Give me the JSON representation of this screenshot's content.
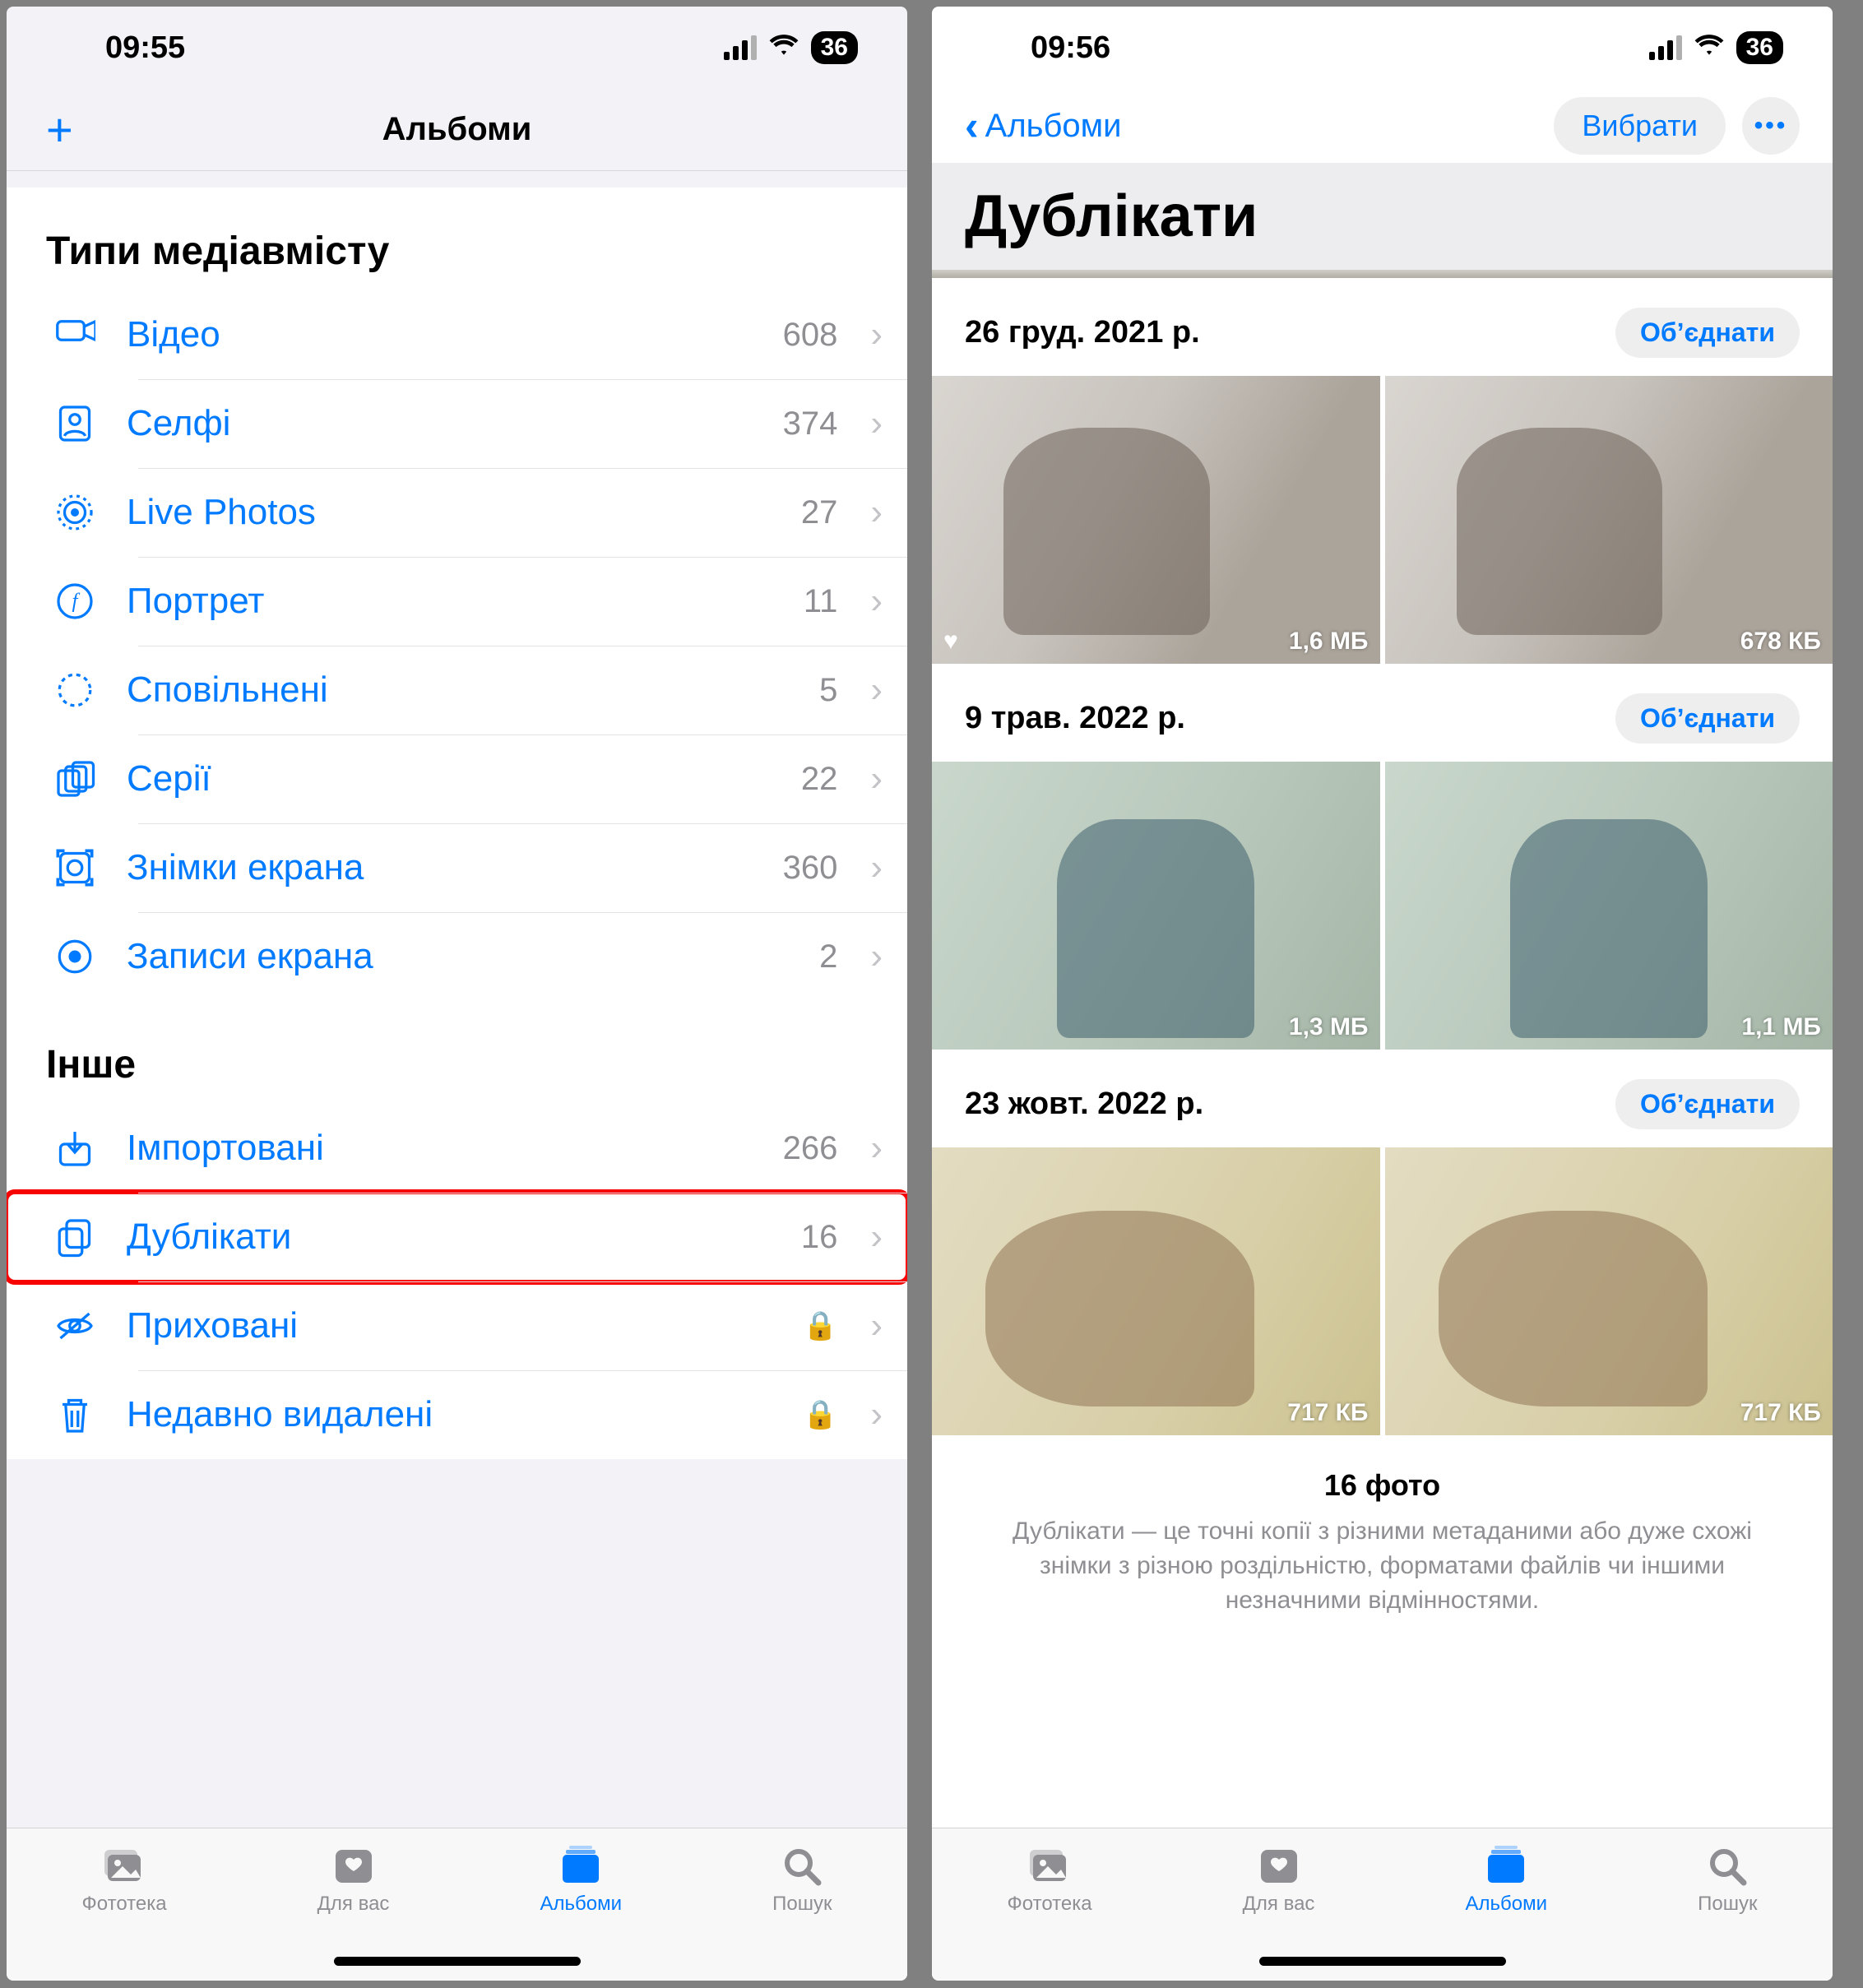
{
  "left": {
    "status_time": "09:55",
    "battery": "36",
    "nav_title": "Альбоми",
    "section_media": "Типи медіавмісту",
    "section_other": "Інше",
    "media_rows": [
      {
        "icon": "video-icon",
        "label": "Відео",
        "count": "608"
      },
      {
        "icon": "selfie-icon",
        "label": "Селфі",
        "count": "374"
      },
      {
        "icon": "livephotos-icon",
        "label": "Live Photos",
        "count": "27"
      },
      {
        "icon": "portrait-icon",
        "label": "Портрет",
        "count": "11"
      },
      {
        "icon": "slowmo-icon",
        "label": "Сповільнені",
        "count": "5"
      },
      {
        "icon": "burst-icon",
        "label": "Серії",
        "count": "22"
      },
      {
        "icon": "screenshot-icon",
        "label": "Знімки екрана",
        "count": "360"
      },
      {
        "icon": "screenrec-icon",
        "label": "Записи екрана",
        "count": "2"
      }
    ],
    "other_rows": [
      {
        "icon": "import-icon",
        "label": "Імпортовані",
        "count": "266",
        "lock": false,
        "hl": false
      },
      {
        "icon": "duplicates-icon",
        "label": "Дублікати",
        "count": "16",
        "lock": false,
        "hl": true
      },
      {
        "icon": "hidden-icon",
        "label": "Приховані",
        "count": "",
        "lock": true,
        "hl": false
      },
      {
        "icon": "trash-icon",
        "label": "Недавно видалені",
        "count": "",
        "lock": true,
        "hl": false
      }
    ]
  },
  "right": {
    "status_time": "09:56",
    "battery": "36",
    "back_label": "Альбоми",
    "select_label": "Вибрати",
    "page_title": "Дублікати",
    "merge_label": "Обʼєднати",
    "groups": [
      {
        "date": "26 груд. 2021 р.",
        "thumbs": [
          {
            "size": "1,6 МБ",
            "heart": true,
            "cls": "ph1"
          },
          {
            "size": "678 КБ",
            "heart": false,
            "cls": "ph1"
          }
        ]
      },
      {
        "date": "9 трав. 2022 р.",
        "thumbs": [
          {
            "size": "1,3 МБ",
            "heart": false,
            "cls": "ph2"
          },
          {
            "size": "1,1 МБ",
            "heart": false,
            "cls": "ph2"
          }
        ]
      },
      {
        "date": "23 жовт. 2022 р.",
        "thumbs": [
          {
            "size": "717 КБ",
            "heart": false,
            "cls": "ph3"
          },
          {
            "size": "717 КБ",
            "heart": false,
            "cls": "ph3"
          }
        ]
      }
    ],
    "footer_count": "16 фото",
    "footer_desc": "Дублікати — це точні копії з різними метаданими або дуже схожі знімки з різною роздільністю, форматами файлів чи іншими незначними відмінностями."
  },
  "tabs": [
    {
      "icon": "library-icon",
      "label": "Фототека"
    },
    {
      "icon": "foryou-icon",
      "label": "Для вас"
    },
    {
      "icon": "albums-icon",
      "label": "Альбоми"
    },
    {
      "icon": "search-icon",
      "label": "Пошук"
    }
  ]
}
